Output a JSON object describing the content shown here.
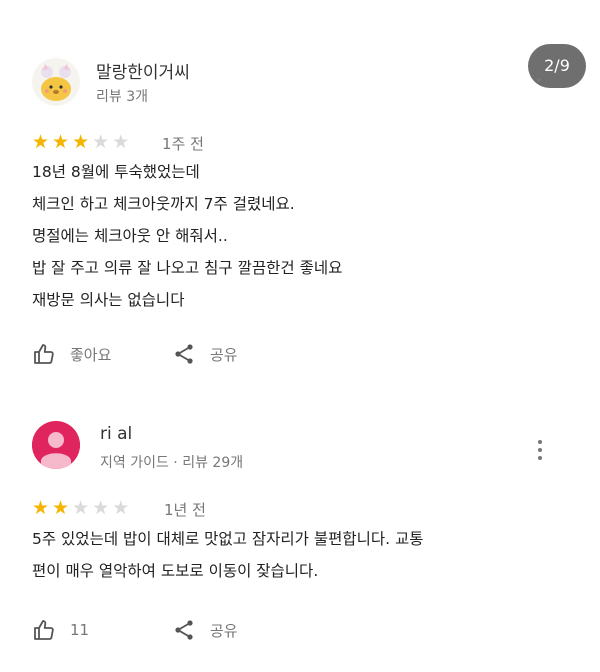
{
  "pager": "2/9",
  "reviews": [
    {
      "author": "말랑한이거씨",
      "meta": "리뷰 3개",
      "rating": 3,
      "time": "1주 전",
      "lines": [
        "18년 8월에 투숙했었는데",
        "체크인 하고 체크아웃까지 7주 걸렸네요.",
        "명절에는 체크아웃 안 해줘서..",
        "밥 잘 주고 의류 잘 나오고 침구 깔끔한건 좋네요",
        "재방문 의사는 없습니다"
      ],
      "like_label": "좋아요",
      "share_label": "공유",
      "avatar_color": "#f7f7f2"
    },
    {
      "author": "ri al",
      "meta": "지역 가이드 · 리뷰 29개",
      "rating": 2,
      "time": "1년 전",
      "lines": [
        "5주 있었는데 밥이 대체로 맛없고 잠자리가 불편합니다. 교통",
        "편이 매우 열악하여 도보로 이동이 잦습니다."
      ],
      "like_label": "11",
      "share_label": "공유",
      "avatar_color": "#e0245e"
    }
  ]
}
